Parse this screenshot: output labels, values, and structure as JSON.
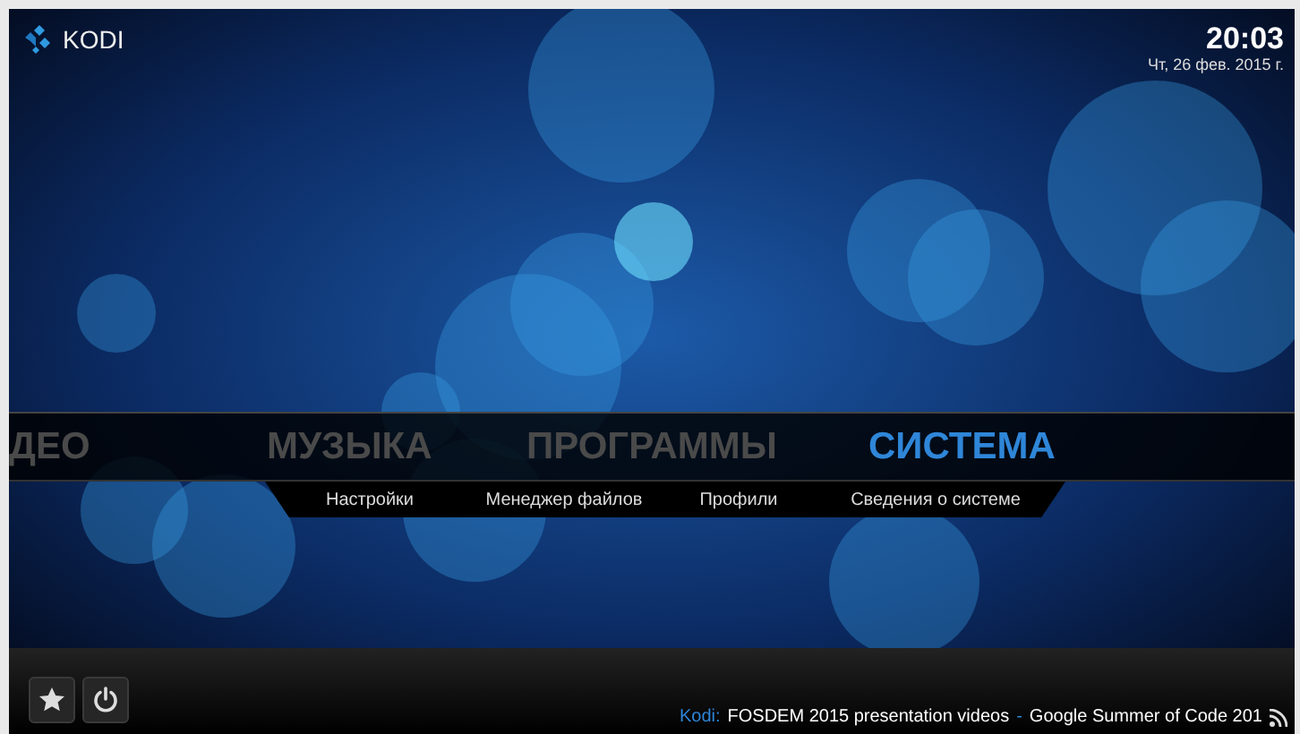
{
  "header": {
    "logo": "KODI",
    "time": "20:03",
    "date": "Чт, 26 фев. 2015 г."
  },
  "main_menu": [
    {
      "label": "ДЕО",
      "selected": false
    },
    {
      "label": "МУЗЫКА",
      "selected": false
    },
    {
      "label": "ПРОГРАММЫ",
      "selected": false
    },
    {
      "label": "СИСТЕМА",
      "selected": true
    }
  ],
  "submenu": [
    "Настройки",
    "Менеджер файлов",
    "Профили",
    "Сведения о системе"
  ],
  "bottom_bar": {
    "buttons": [
      {
        "kind": "favourites"
      },
      {
        "kind": "power"
      }
    ],
    "ticker": [
      {
        "kind": "source",
        "text": "Kodi:"
      },
      {
        "kind": "headline",
        "text": "FOSDEM 2015 presentation videos"
      },
      {
        "kind": "separator",
        "text": "-"
      },
      {
        "kind": "headline",
        "text": "Google Summer of Code 201"
      }
    ]
  }
}
